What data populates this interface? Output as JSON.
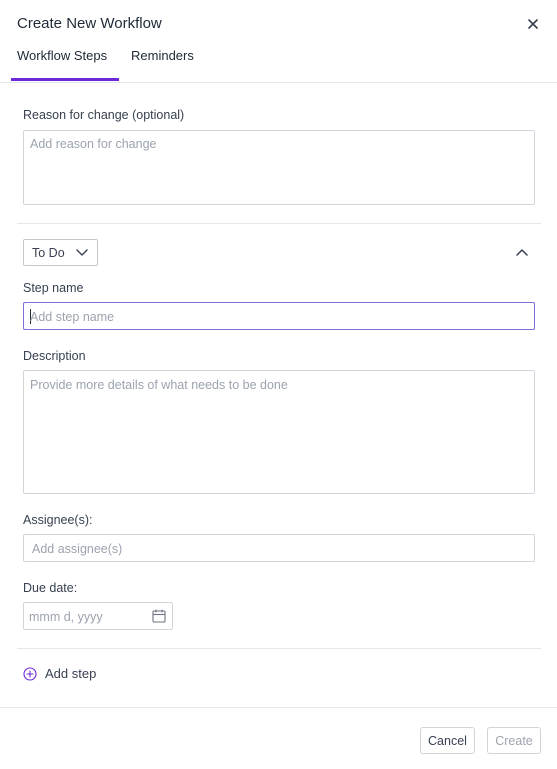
{
  "modal": {
    "title": "Create New Workflow",
    "close_icon": "close-icon"
  },
  "tabs": [
    {
      "label": "Workflow Steps",
      "active": true
    },
    {
      "label": "Reminders",
      "active": false
    }
  ],
  "reason": {
    "label": "Reason for change (optional)",
    "placeholder": "Add reason for change"
  },
  "step": {
    "status": "To Do",
    "name_label": "Step name",
    "name_placeholder": "Add step name",
    "description_label": "Description",
    "description_placeholder": "Provide more details of what needs to be done",
    "assignee_label": "Assignee(s):",
    "assignee_placeholder": "Add assignee(s)",
    "due_label": "Due date:",
    "due_placeholder": "mmm d, yyyy"
  },
  "add_step_label": "Add step",
  "footer": {
    "cancel_label": "Cancel",
    "create_label": "Create"
  },
  "colors": {
    "accent": "#6d28d9",
    "focus_border": "#7c6fd6",
    "placeholder": "#9ca3af"
  }
}
